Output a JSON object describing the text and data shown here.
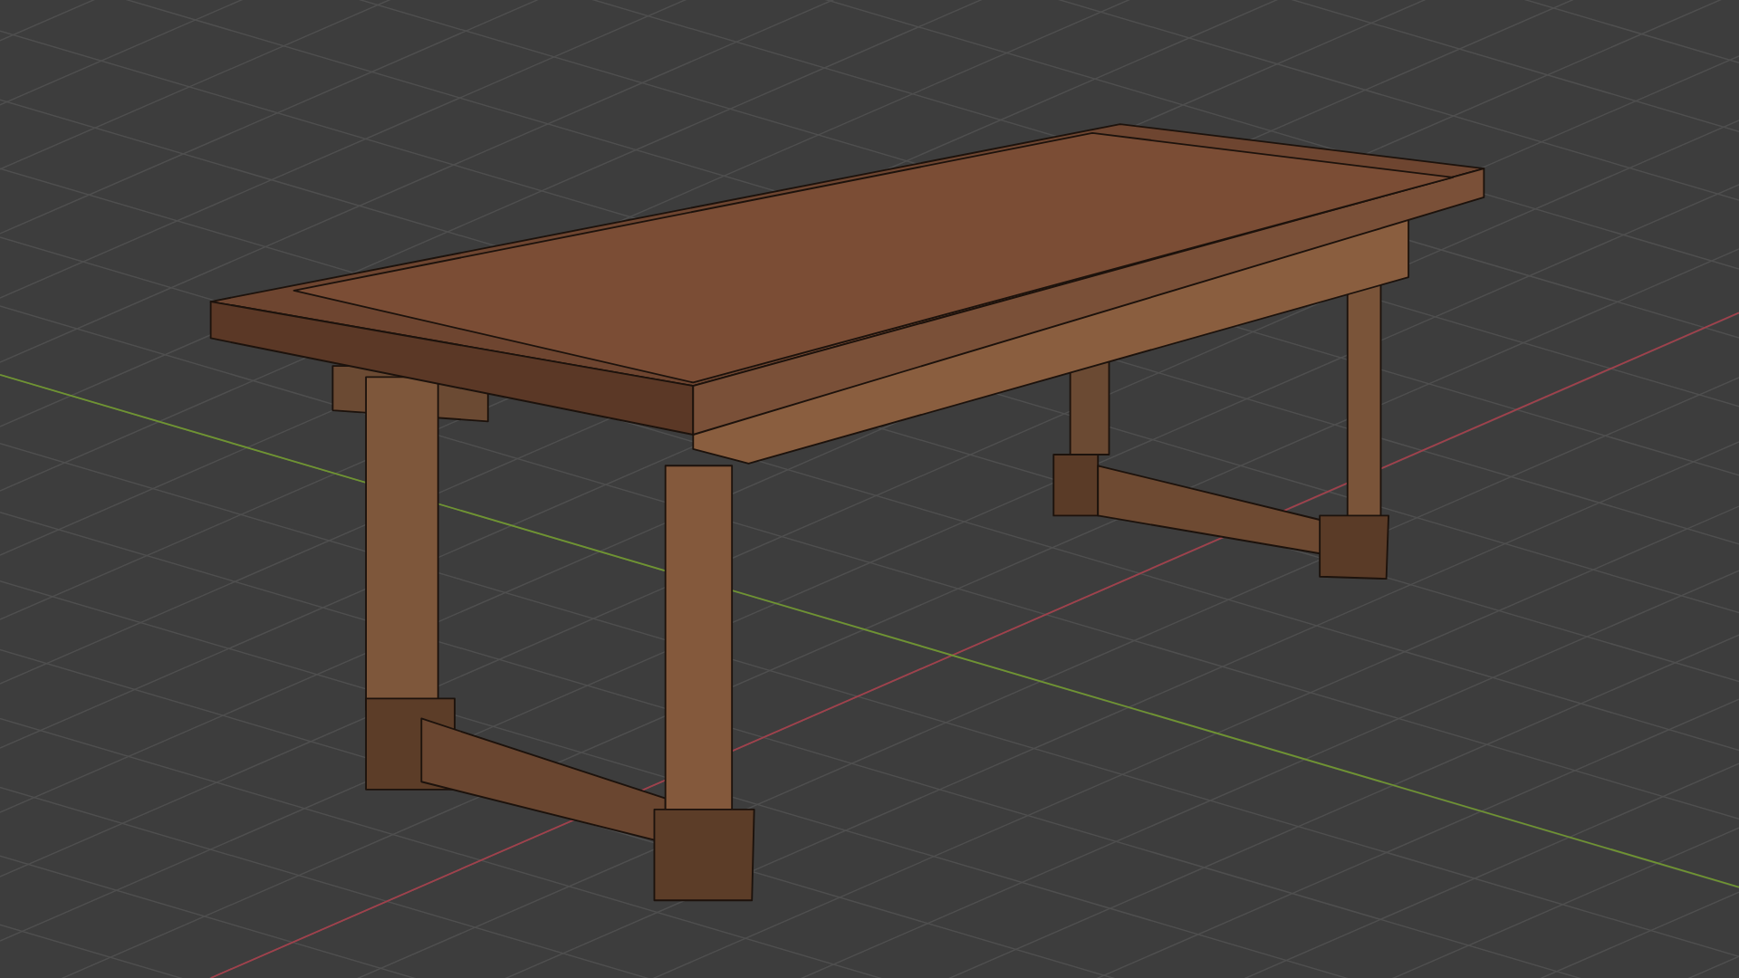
{
  "viewport": {
    "show_grid": true,
    "show_x_axis": true,
    "show_y_axis": true
  }
}
